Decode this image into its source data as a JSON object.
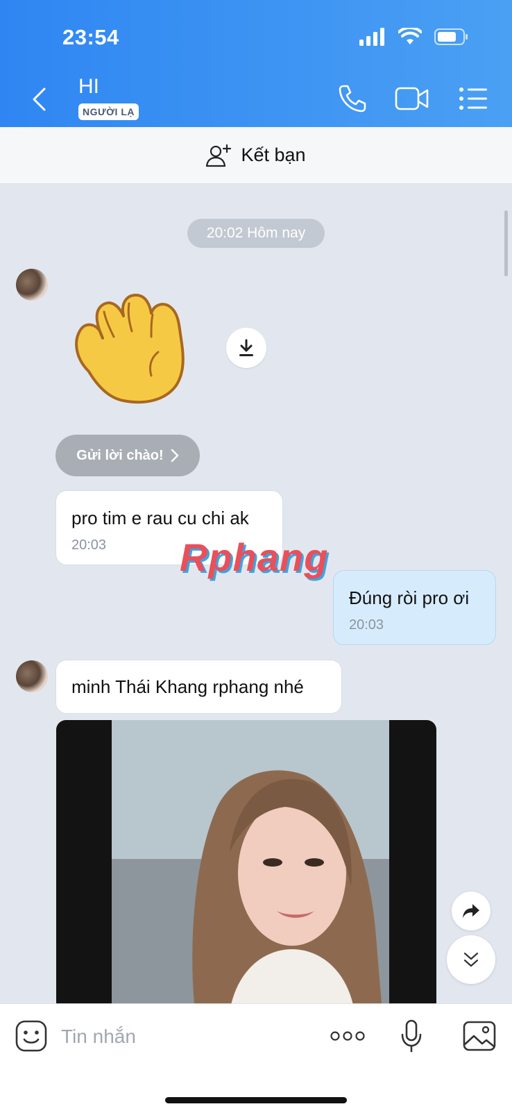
{
  "status_bar": {
    "time": "23:54"
  },
  "header": {
    "contact_name": "HI",
    "badge": "NGƯỜI LẠ"
  },
  "add_friend": {
    "label": "Kết bạn"
  },
  "chat": {
    "date_label": "20:02 Hôm nay",
    "hello_button": "Gửi lời chào!",
    "messages": [
      {
        "direction": "in",
        "text": "pro tim e rau cu chi ak",
        "time": "20:03"
      },
      {
        "direction": "out",
        "text": "Đúng ròi pro ơi",
        "time": "20:03"
      },
      {
        "direction": "in",
        "text": "minh Thái Khang rphang nhé",
        "time": ""
      }
    ]
  },
  "watermark": "Rphang",
  "composer": {
    "placeholder": "Tin nhắn"
  },
  "colors": {
    "header_start": "#2f86f2",
    "header_end": "#4aa0f3",
    "chat_bg": "#e2e7ef",
    "out_bubble": "#d6ecfd"
  }
}
